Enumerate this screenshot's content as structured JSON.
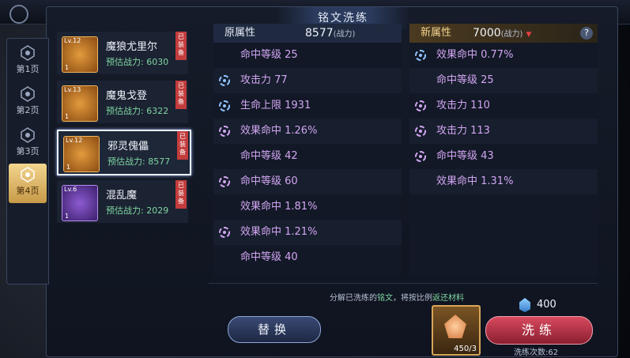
{
  "title": "铭文洗练",
  "pages": [
    {
      "label": "第1页",
      "active": false
    },
    {
      "label": "第2页",
      "active": false
    },
    {
      "label": "第3页",
      "active": false
    },
    {
      "label": "第4页",
      "active": true
    }
  ],
  "equip_list": [
    {
      "name": "魔狼尤里尔",
      "power": "预估战力: 6030",
      "level": "Lv.12",
      "count": "1",
      "equipped": "已装备",
      "theme": "orange",
      "selected": false
    },
    {
      "name": "魔鬼戈登",
      "power": "预估战力: 6322",
      "level": "Lv.13",
      "count": "1",
      "equipped": "已装备",
      "theme": "orange",
      "selected": false
    },
    {
      "name": "邪灵傀儡",
      "power": "预估战力: 8577",
      "level": "Lv.12",
      "count": "1",
      "equipped": "已装备",
      "theme": "orange",
      "selected": true
    },
    {
      "name": "混乱魔",
      "power": "预估战力: 2029",
      "level": "Lv.6",
      "count": "1",
      "equipped": "已装备",
      "theme": "purple",
      "selected": false
    }
  ],
  "original": {
    "label": "原属性",
    "power": "8577",
    "unit": "(战力)",
    "attrs": [
      {
        "text": "命中等级 25",
        "icon": "none",
        "color": "pink"
      },
      {
        "text": "攻击力 77",
        "icon": "blue",
        "color": "pink"
      },
      {
        "text": "生命上限 1931",
        "icon": "blue",
        "color": "pink"
      },
      {
        "text": "效果命中 1.26%",
        "icon": "pink",
        "color": "pink"
      },
      {
        "text": "命中等级 42",
        "icon": "none",
        "color": "pink"
      },
      {
        "text": "命中等级 60",
        "icon": "pink",
        "color": "pink"
      },
      {
        "text": "效果命中 1.81%",
        "icon": "none",
        "color": "pink"
      },
      {
        "text": "效果命中 1.21%",
        "icon": "pink",
        "color": "pink"
      },
      {
        "text": "命中等级 40",
        "icon": "none",
        "color": "pink"
      }
    ]
  },
  "new": {
    "label": "新属性",
    "power": "7000",
    "unit": "(战力)",
    "help": "?",
    "attrs": [
      {
        "text": "效果命中 0.77%",
        "icon": "blue",
        "color": "pink"
      },
      {
        "text": "命中等级 25",
        "icon": "none",
        "color": "pink"
      },
      {
        "text": "攻击力 110",
        "icon": "pink",
        "color": "pink"
      },
      {
        "text": "攻击力 113",
        "icon": "pink",
        "color": "pink"
      },
      {
        "text": "命中等级 43",
        "icon": "pink",
        "color": "pink"
      },
      {
        "text": "效果命中 1.31%",
        "icon": "none",
        "color": "pink"
      }
    ]
  },
  "hint": {
    "pre": "分解已洗练的",
    "hl1": "铭文",
    "mid": "，将按比例",
    "hl2": "返还材料"
  },
  "swap_button": "替换",
  "material": {
    "count": "450/3"
  },
  "cost": "400",
  "wash_button": "洗练",
  "wash_times": "洗练次数:62",
  "colors": {
    "accent_gold": "#f3d58f",
    "wash_red": "#d84a5e",
    "attr_pink": "#d2a6f2",
    "attr_blue": "#8fc4ff",
    "power_green": "#7fd6a0"
  }
}
